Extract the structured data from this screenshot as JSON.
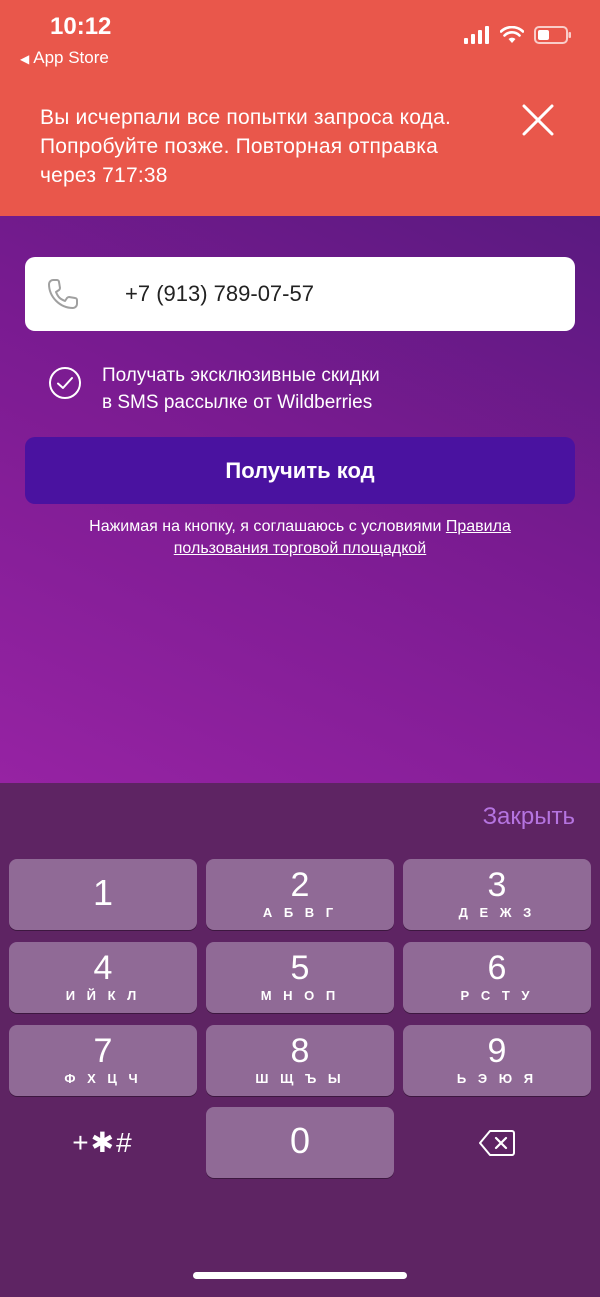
{
  "status_bar": {
    "time": "10:12",
    "back_app": "App Store"
  },
  "alert": {
    "message": "Вы исчерпали все попытки запроса кода. Попробуйте позже.  Повторная отправка через 717:38"
  },
  "form": {
    "phone_value": "+7 (913) 789-07-57",
    "optin_line1": "Получать эксклюзивные скидки",
    "optin_line2": "в SMS рассылке от Wildberries",
    "submit_label": "Получить код",
    "terms_prefix": "Нажимая на кнопку, я соглашаюсь с условиями ",
    "terms_link": "Правила пользования торговой площадкой"
  },
  "keyboard": {
    "close_label": "Закрыть",
    "keys": [
      {
        "digit": "1",
        "letters": ""
      },
      {
        "digit": "2",
        "letters": "А Б В Г"
      },
      {
        "digit": "3",
        "letters": "Д Е Ж З"
      },
      {
        "digit": "4",
        "letters": "И Й К Л"
      },
      {
        "digit": "5",
        "letters": "М Н О П"
      },
      {
        "digit": "6",
        "letters": "Р С Т У"
      },
      {
        "digit": "7",
        "letters": "Ф Х Ц Ч"
      },
      {
        "digit": "8",
        "letters": "Ш Щ Ъ Ы"
      },
      {
        "digit": "9",
        "letters": "Ь Э Ю Я"
      },
      {
        "digit": "0",
        "letters": ""
      }
    ],
    "symbols_label": "+✱#"
  },
  "colors": {
    "alert_bg": "#e9574b",
    "button_bg": "#4a12a0",
    "keyboard_bg": "#5e2463",
    "key_bg": "#906a96",
    "close_text": "#b574e0"
  },
  "icons": [
    "signal-icon",
    "wifi-icon",
    "battery-icon",
    "close-icon",
    "phone-icon",
    "check-circle-icon",
    "backspace-icon"
  ]
}
